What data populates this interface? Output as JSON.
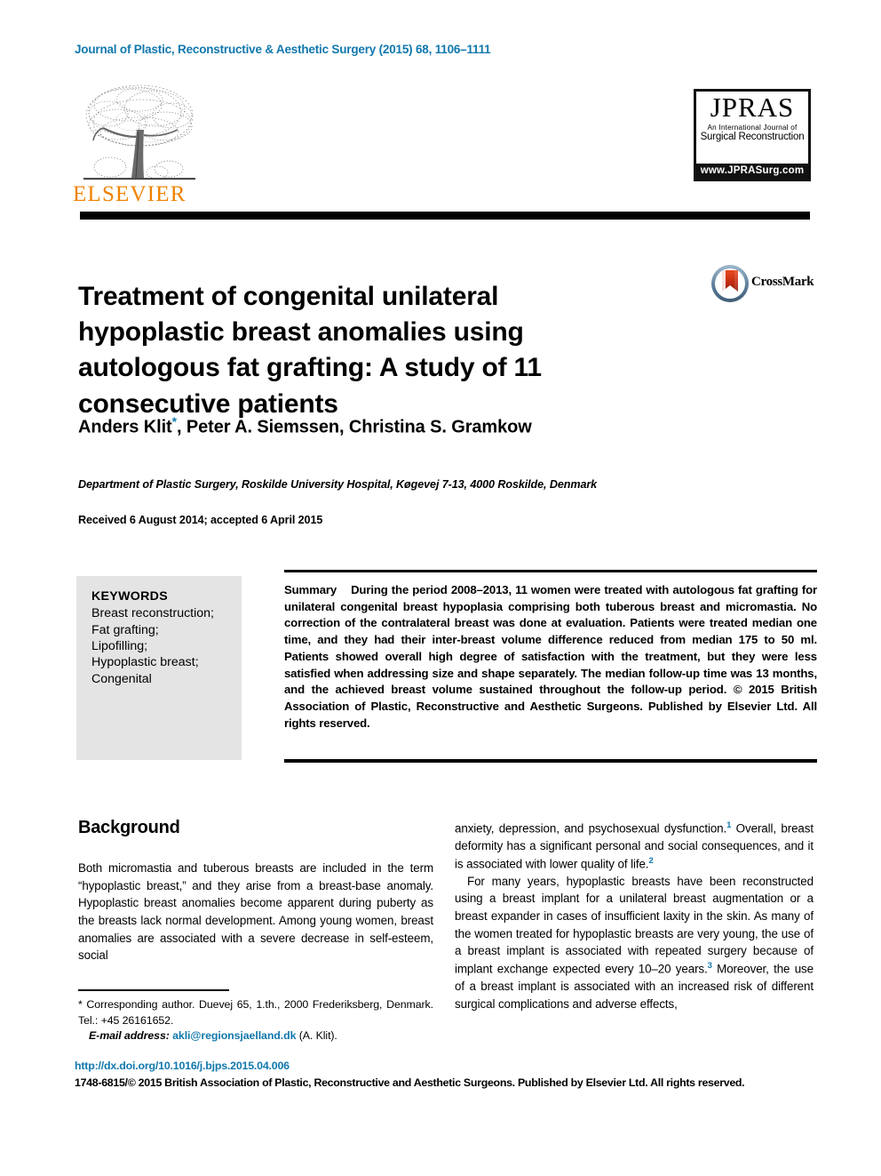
{
  "header": {
    "journal_reference": "Journal of Plastic, Reconstructive & Aesthetic Surgery (2015) 68, 1106–1111",
    "link_color": "#1178ad"
  },
  "publisher_logo": {
    "wordmark": "ELSEVIER",
    "wordmark_color": "#ef8200",
    "icon": "elsevier-tree-icon"
  },
  "journal_logo": {
    "title": "JPRAS",
    "subtitle_line1": "An International Journal of",
    "subtitle_line2": "Surgical Reconstruction",
    "url": "www.JPRASurg.com"
  },
  "crossmark": {
    "label": "CrossMark",
    "icon": "crossmark-icon"
  },
  "article": {
    "title": "Treatment of congenital unilateral hypoplastic breast anomalies using autologous fat grafting: A study of 11 consecutive patients",
    "authors": "Anders Klit",
    "authors_rest": ", Peter A. Siemssen, Christina S. Gramkow",
    "corresponding_marker": "*",
    "affiliation": "Department of Plastic Surgery, Roskilde University Hospital, Køgevej 7-13, 4000 Roskilde, Denmark",
    "dates": "Received 6 August 2014; accepted 6 April 2015"
  },
  "keywords": {
    "heading": "KEYWORDS",
    "items": [
      "Breast reconstruction;",
      "Fat grafting;",
      "Lipofilling;",
      "Hypoplastic breast;",
      "Congenital"
    ]
  },
  "abstract": {
    "label": "Summary",
    "text": "During the period 2008–2013, 11 women were treated with autologous fat grafting for unilateral congenital breast hypoplasia comprising both tuberous breast and micromastia. No correction of the contralateral breast was done at evaluation. Patients were treated median one time, and they had their inter-breast volume difference reduced from median 175 to 50 ml. Patients showed overall high degree of satisfaction with the treatment, but they were less satisfied when addressing size and shape separately. The median follow-up time was 13 months, and the achieved breast volume sustained throughout the follow-up period.",
    "rights": "© 2015 British Association of Plastic, Reconstructive and Aesthetic Surgeons. Published by Elsevier Ltd. All rights reserved."
  },
  "body": {
    "section_heading": "Background",
    "left_paragraph_1": "Both micromastia and tuberous breasts are included in the term “hypoplastic breast,” and they arise from a breast-base anomaly. Hypoplastic breast anomalies become apparent during puberty as the breasts lack normal development. Among young women, breast anomalies are associated with a severe decrease in self-esteem, social",
    "right_paragraph_1_a": "anxiety, depression, and psychosexual dysfunction.",
    "right_paragraph_1_ref": "1",
    "right_paragraph_1_b": " Overall, breast deformity has a significant personal and social consequences, and it is associated with lower quality of life.",
    "right_paragraph_1_ref2": "2",
    "right_paragraph_2_a": "For many years, hypoplastic breasts have been reconstructed using a breast implant for a unilateral breast augmentation or a breast expander in cases of insufficient laxity in the skin. As many of the women treated for hypoplastic breasts are very young, the use of a breast implant is associated with repeated surgery because of implant exchange expected every 10–20 years.",
    "right_paragraph_2_ref": "3",
    "right_paragraph_2_b": " Moreover, the use of a breast implant is associated with an increased risk of different surgical complications and adverse effects,"
  },
  "footnote": {
    "line1": "* Corresponding author. Duevej 65, 1.th., 2000 Frederiksberg, Denmark. Tel.: +45 26161652.",
    "email_label": "E-mail address:",
    "email": "akli@regionsjaelland.dk",
    "email_attribution": "(A. Klit)."
  },
  "footer": {
    "doi": "http://dx.doi.org/10.1016/j.bjps.2015.04.006",
    "copyright": "1748-6815/© 2015 British Association of Plastic, Reconstructive and Aesthetic Surgeons. Published by Elsevier Ltd. All rights reserved."
  }
}
